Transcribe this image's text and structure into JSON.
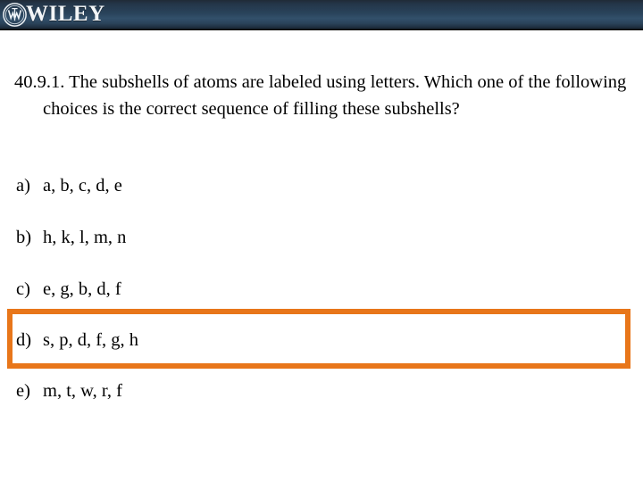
{
  "header": {
    "brand": "WILEY",
    "logo_icon": "wiley-circular-monogram-icon",
    "bg_top_color": "#16222e",
    "bg_mid_color": "#32506b",
    "bg_bottom_color": "#0d1319"
  },
  "slide": {
    "question": {
      "number": "40.9.1.",
      "text": "The subshells of atoms are labeled using letters.  Which one of the following choices is the correct sequence of filling these subshells?"
    },
    "choices": [
      {
        "label": "a)",
        "text": "a, b, c, d, e",
        "highlighted": false
      },
      {
        "label": "b)",
        "text": "h, k, l, m, n",
        "highlighted": false
      },
      {
        "label": "c)",
        "text": "e, g, b, d, f",
        "highlighted": false
      },
      {
        "label": "d)",
        "text": "s, p, d, f, g, h",
        "highlighted": true
      },
      {
        "label": "e)",
        "text": "m, t, w, r, f",
        "highlighted": false
      }
    ],
    "highlight_color": "#e8761a"
  }
}
